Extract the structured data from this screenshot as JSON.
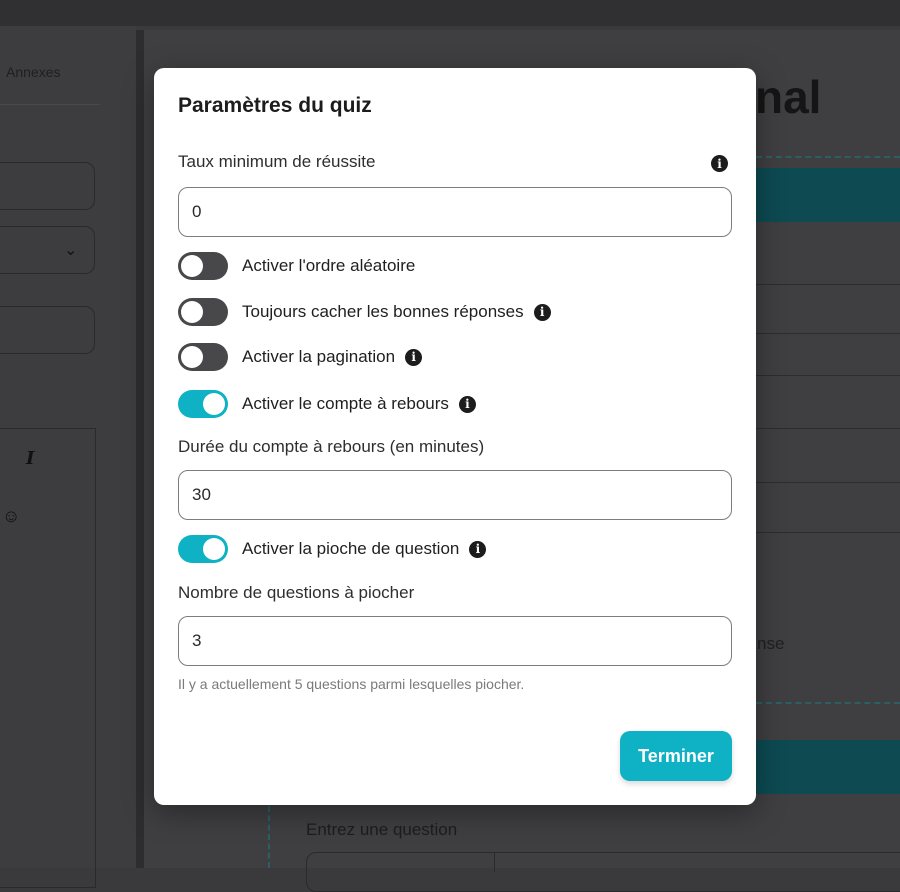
{
  "background": {
    "tab_label": "Annexes",
    "heading_fragment": "nal",
    "side_text_fragment": "nse",
    "question_prompt": "Entrez une question"
  },
  "modal": {
    "title": "Paramètres du quiz",
    "min_rate": {
      "label": "Taux minimum de réussite",
      "value": "0"
    },
    "toggles": [
      {
        "label": "Activer l'ordre aléatoire",
        "on": false,
        "has_info": false
      },
      {
        "label": "Toujours cacher les bonnes réponses",
        "on": false,
        "has_info": true
      },
      {
        "label": "Activer la pagination",
        "on": false,
        "has_info": true
      },
      {
        "label": "Activer le compte à rebours",
        "on": true,
        "has_info": true
      },
      {
        "label": "Activer la pioche de question",
        "on": true,
        "has_info": true
      }
    ],
    "countdown": {
      "label": "Durée du compte à rebours (en minutes)",
      "value": "30"
    },
    "draw": {
      "label": "Nombre de questions à piocher",
      "value": "3",
      "help": "Il y a actuellement 5 questions parmi lesquelles piocher."
    },
    "finish_label": "Terminer",
    "info_glyph": "i"
  },
  "colors": {
    "accent": "#0eb2c4",
    "toggle_off": "#48484a",
    "overlay": "#3a3a3c"
  },
  "icons": {
    "info": "info-circle-icon",
    "chevron": "chevron-down-icon",
    "italic": "italic-icon",
    "emoji": "smiley-icon"
  }
}
